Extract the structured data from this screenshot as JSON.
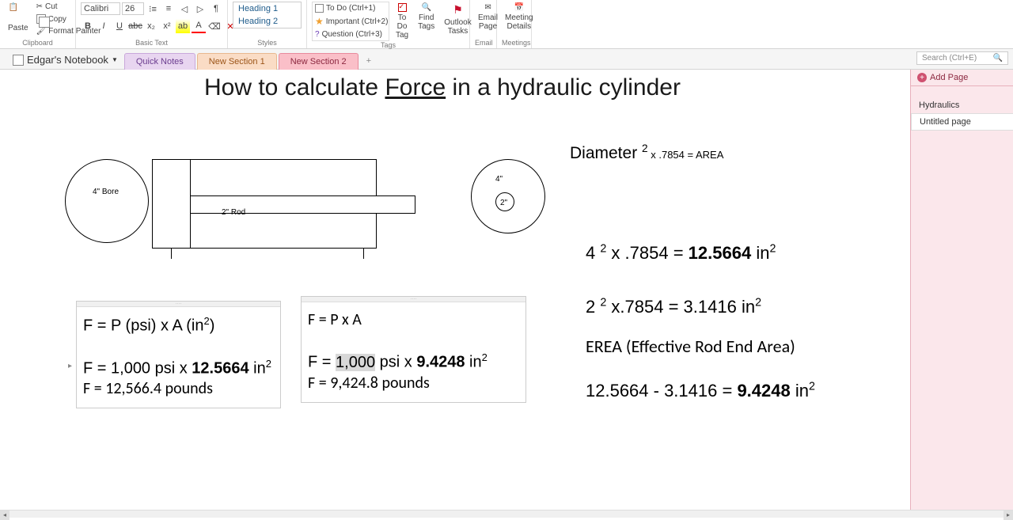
{
  "ribbon": {
    "clipboard": {
      "label": "Clipboard",
      "paste": "Paste",
      "cut": "Cut",
      "copy": "Copy",
      "format_painter": "Format Painter"
    },
    "font": {
      "label": "Basic Text",
      "name": "Calibri",
      "size": "26"
    },
    "styles": {
      "label": "Styles",
      "h1": "Heading 1",
      "h2": "Heading 2"
    },
    "tags": {
      "label": "Tags",
      "todo": "To Do (Ctrl+1)",
      "important": "Important (Ctrl+2)",
      "question": "Question (Ctrl+3)",
      "todo_tag": "To Do Tag",
      "find_tags": "Find Tags",
      "outlook_tasks": "Outlook Tasks"
    },
    "email": {
      "label": "Email",
      "page": "Email Page"
    },
    "meetings": {
      "label": "Meetings",
      "details": "Meeting Details"
    }
  },
  "notebook": {
    "name": "Edgar's Notebook",
    "tabs": {
      "quick": "Quick Notes",
      "sec1": "New Section 1",
      "sec2": "New Section 2"
    },
    "search_placeholder": "Search (Ctrl+E)"
  },
  "pages": {
    "add": "Add Page",
    "p1": "Hydraulics",
    "p2": "Untitled page"
  },
  "content": {
    "title_a": "How to calculate ",
    "title_force": "Force",
    "title_b": " in a hydraulic cylinder",
    "bore_label": "4\" Bore",
    "rod_label": "2\" Rod",
    "ring_outer": "4\"",
    "ring_inner": "2\"",
    "diam_formula_a": "Diameter ",
    "diam_formula_b": " x .7854 = AREA",
    "calc1_a": "4 ",
    "calc1_b": " x .7854 = ",
    "calc1_c": "12.5664",
    "calc1_d": " in",
    "calc2": "2 ",
    "calc2_b": " x.7854 = 3.1416 in",
    "erea": "EREA (Effective Rod End Area)",
    "calc3_a": "12.5664 - 3.1416 = ",
    "calc3_b": "9.4248",
    "calc3_c": " in",
    "box1_l1": "F = P (psi)  x A (in",
    "box1_l1b": ")",
    "box1_l2_a": "F = 1,000 psi x ",
    "box1_l2_b": "12.5664",
    "box1_l2_c": " in",
    "box1_l3": "F =  12,566.4 pounds",
    "box2_l1": "F = P x A",
    "box2_l2_a": "F = ",
    "box2_l2_hl": "1,000",
    "box2_l2_b": " psi x ",
    "box2_l2_c": "9.4248",
    "box2_l2_d": " in",
    "box2_l3": "F = 9,424.8 pounds"
  }
}
